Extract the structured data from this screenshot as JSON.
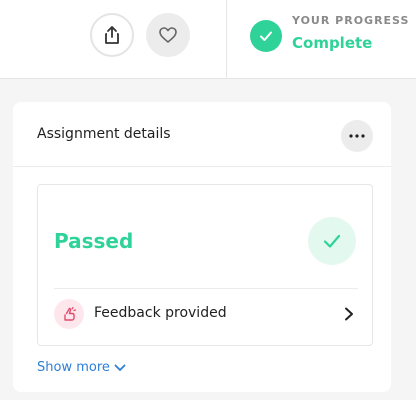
{
  "header": {
    "progress_label": "YOUR PROGRESS",
    "progress_value": "Complete"
  },
  "card": {
    "title": "Assignment details",
    "status": "Passed",
    "feedback_label": "Feedback provided",
    "show_more": "Show more"
  },
  "colors": {
    "accent_green": "#2fd39a",
    "link_blue": "#2d7fd6",
    "feedback_pink": "#e04d6b"
  },
  "icons": [
    "share-icon",
    "heart-icon",
    "check-icon",
    "more-icon",
    "feedback-icon",
    "chevron-right-icon",
    "chevron-down-icon"
  ]
}
